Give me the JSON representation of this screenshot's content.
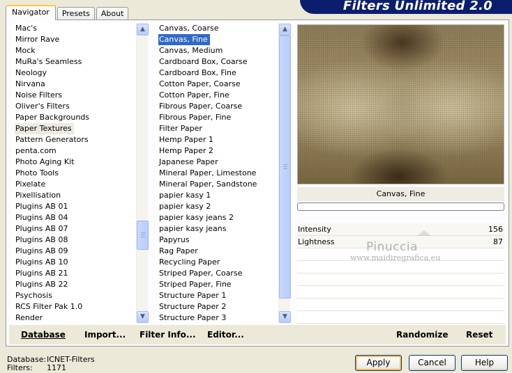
{
  "tabs": [
    "Navigator",
    "Presets",
    "About"
  ],
  "title": "Filters Unlimited 2.0",
  "categories": {
    "items": [
      "Mac's",
      "Mirror Rave",
      "Mock",
      "MuRa's Seamless",
      "Neology",
      "Nirvana",
      "Noise Filters",
      "Oliver's Filters",
      "Paper Backgrounds",
      "Paper Textures",
      "Pattern Generators",
      "penta.com",
      "Photo Aging Kit",
      "Photo Tools",
      "Pixelate",
      "Pixellisation",
      "Plugins AB 01",
      "Plugins AB 04",
      "Plugins AB 07",
      "Plugins AB 08",
      "Plugins AB 09",
      "Plugins AB 10",
      "Plugins AB 21",
      "Plugins AB 22",
      "Psychosis",
      "RCS Filter Pak 1.0",
      "Render"
    ],
    "selected": "Paper Textures"
  },
  "filters": {
    "items": [
      "Canvas, Coarse",
      "Canvas, Fine",
      "Canvas, Medium",
      "Cardboard Box, Coarse",
      "Cardboard Box, Fine",
      "Cotton Paper, Coarse",
      "Cotton Paper, Fine",
      "Fibrous Paper, Coarse",
      "Fibrous Paper, Fine",
      "Filter Paper",
      "Hemp Paper 1",
      "Hemp Paper 2",
      "Japanese Paper",
      "Mineral Paper, Limestone",
      "Mineral Paper, Sandstone",
      "papier kasy 1",
      "papier kasy 2",
      "papier kasy jeans 2",
      "papier kasy jeans",
      "Papyrus",
      "Rag Paper",
      "Recycling Paper",
      "Striped Paper, Coarse",
      "Striped Paper, Fine",
      "Structure Paper 1",
      "Structure Paper 2",
      "Structure Paper 3"
    ],
    "selected": "Canvas, Fine"
  },
  "preview": {
    "filter_name": "Canvas, Fine",
    "progress": 0
  },
  "params": [
    {
      "label": "Intensity",
      "value": "156"
    },
    {
      "label": "Lightness",
      "value": "87"
    }
  ],
  "watermark": {
    "line1": "Pinuccia",
    "line2": "www.maidiregrafica.eu"
  },
  "toolbar": {
    "database": "Database",
    "import": "Import...",
    "filter_info": "Filter Info...",
    "editor": "Editor...",
    "randomize": "Randomize",
    "reset": "Reset"
  },
  "status": {
    "database_label": "Database:",
    "database_value": "ICNET-Filters",
    "filters_label": "Filters:",
    "filters_value": "1171"
  },
  "buttons": {
    "apply": "Apply",
    "cancel": "Cancel",
    "help": "Help"
  },
  "colors": {
    "selection": "#316AC5",
    "banner": "#0B1E6E",
    "dialog": "#ECE9D8"
  }
}
